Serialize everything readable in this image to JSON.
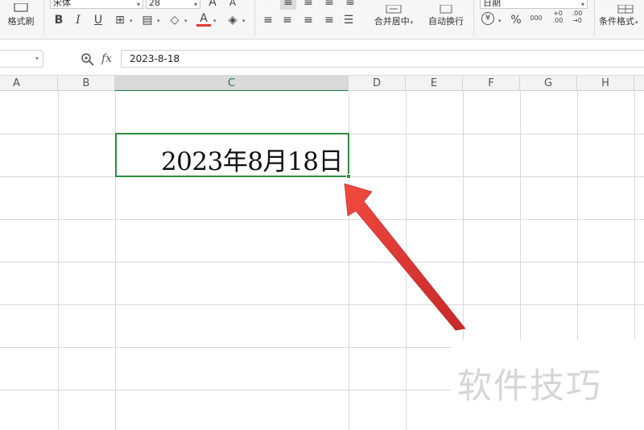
{
  "ribbon": {
    "format_painter_label": "格式刷",
    "font_name": "宋体",
    "font_size": "28",
    "bold": "B",
    "italic": "I",
    "underline": "U",
    "merge_center_label": "合并居中",
    "auto_wrap_label": "自动换行",
    "number_format": "日期",
    "currency_symbol": "¥",
    "percent_symbol": "%",
    "thousands_symbol": "000",
    "increase_decimal": "+0 .00",
    "decrease_decimal": ".00 →0",
    "conditional_format_label": "条件格式"
  },
  "formula_bar": {
    "fx_label": "fx",
    "formula_value": "2023-8-18"
  },
  "columns": [
    "A",
    "B",
    "C",
    "D",
    "E",
    "F",
    "G",
    "H"
  ],
  "selected_column": "C",
  "cell_c3": {
    "display_value": "2023年8月18日"
  },
  "watermark": "软件技巧",
  "colors": {
    "selection_green": "#2e8b3e",
    "arrow_red": "#e53935",
    "font_color_red": "#e53935"
  }
}
